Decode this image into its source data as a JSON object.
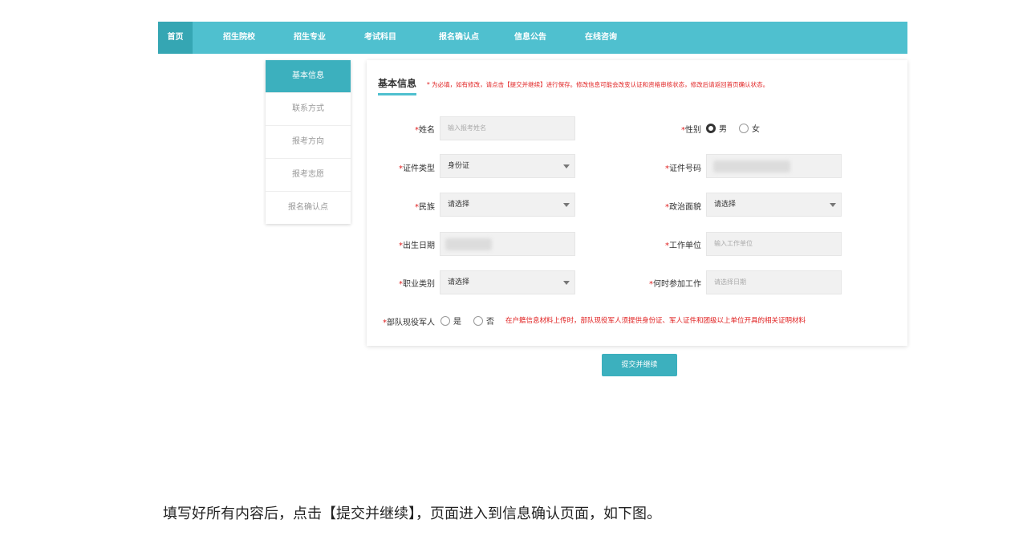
{
  "nav": {
    "items": [
      {
        "label": "首页"
      },
      {
        "label": "招生院校"
      },
      {
        "label": "招生专业"
      },
      {
        "label": "考试科目"
      },
      {
        "label": "报名确认点"
      },
      {
        "label": "信息公告"
      },
      {
        "label": "在线咨询"
      }
    ],
    "active_index": 0,
    "color": "#4fc0cf"
  },
  "sidebar": {
    "items": [
      {
        "label": "基本信息"
      },
      {
        "label": "联系方式"
      },
      {
        "label": "报考方向"
      },
      {
        "label": "报考志愿"
      },
      {
        "label": "报名确认点"
      }
    ],
    "active_index": 0
  },
  "form": {
    "title": "基本信息",
    "notice": "* 为必填，如有修改，请点击【提交并继续】进行保存。修改信息可能会改变认证和资格审核状态，修改后请返回首页确认状态。",
    "required_mark": "*",
    "name": {
      "label": "姓名",
      "placeholder": "输入报考姓名"
    },
    "gender": {
      "label": "性别",
      "options": [
        "男",
        "女"
      ],
      "selected": "男"
    },
    "id_type": {
      "label": "证件类型",
      "value": "身份证"
    },
    "id_number": {
      "label": "证件号码"
    },
    "ethnicity": {
      "label": "民族",
      "value": "请选择"
    },
    "political_status": {
      "label": "政治面貌",
      "value": "请选择"
    },
    "birth_date": {
      "label": "出生日期"
    },
    "work_unit": {
      "label": "工作单位",
      "placeholder": "输入工作单位"
    },
    "occupation": {
      "label": "职业类别",
      "value": "请选择"
    },
    "work_start": {
      "label": "何时参加工作",
      "placeholder": "请选择日期"
    },
    "military": {
      "label": "部队现役军人",
      "options": [
        "是",
        "否"
      ],
      "warning": "在户籍信息材料上传时，部队现役军人须提供身份证、军人证件和团级以上单位开具的相关证明材料"
    },
    "submit_label": "提交并继续"
  },
  "caption": "填写好所有内容后，点击【提交并继续】，页面进入到信息确认页面，如下图。"
}
